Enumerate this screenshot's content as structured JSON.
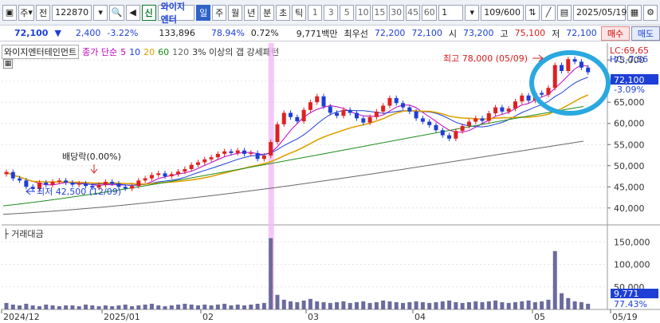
{
  "toolbar": {
    "market": "주",
    "prev_label": "전",
    "code": "122870",
    "new_badge": "신",
    "stock_name": "와이지엔터",
    "periods": [
      "일",
      "주",
      "월",
      "년",
      "분",
      "초",
      "틱"
    ],
    "active_period": "일",
    "intervals": [
      "1",
      "3",
      "5",
      "10",
      "15",
      "30",
      "45",
      "60"
    ],
    "interval_value": "1",
    "count": "109/600",
    "date": "2025/05/19"
  },
  "quote": {
    "price": "72,100",
    "change": "2,400",
    "change_rate": "-3.22%",
    "volume": "133,896",
    "ratio1": "78.94%",
    "ratio2": "0.72%",
    "amount": "9,771백만",
    "ask_label": "최우선",
    "ask": "72,200",
    "bid": "72,100",
    "open_label": "시",
    "open": "73,200",
    "high_label": "고",
    "high": "75,100",
    "low_label": "저",
    "low": "72,100",
    "buy_label": "매수",
    "sell_label": "매도"
  },
  "legend": {
    "name": "와이지엔터테인먼트",
    "price_type": "종가 단순",
    "ma": [
      "5",
      "10",
      "20",
      "60",
      "120"
    ],
    "pattern": "3% 이상의 갭 강세패턴"
  },
  "chart_data": {
    "type": "candlestick",
    "price_axis": [
      "75,000",
      "70,000",
      "65,000",
      "60,000",
      "55,000",
      "50,000",
      "45,000",
      "40,000"
    ],
    "price_range": [
      36000,
      79000
    ],
    "volume_axis": [
      "150,000",
      "100,000",
      "50,000"
    ],
    "volume_label": "거래대금",
    "x_labels": [
      "2024/12",
      "2025/01",
      "02",
      "03",
      "04",
      "05",
      "05/19"
    ],
    "annotations": {
      "high": "최고 78,000 (05/09)",
      "low": "최저 42,500 (12/09)",
      "dividend": "배당락(0.00%)"
    },
    "side_labels": {
      "lc": "LC:69,65",
      "hc": "HC:-7,56",
      "current": "72,100",
      "current_rate": "-3.09%",
      "vol_current": "9,771",
      "vol_rate": "77.43%"
    },
    "candles": [
      [
        48000,
        48500
      ],
      [
        48500,
        47000
      ],
      [
        47000,
        46500
      ],
      [
        46500,
        45000
      ],
      [
        45000,
        44500
      ],
      [
        44500,
        46000
      ],
      [
        46000,
        45500
      ],
      [
        45500,
        46200
      ],
      [
        46200,
        46500
      ],
      [
        46500,
        46000
      ],
      [
        46000,
        45500
      ],
      [
        45500,
        45800
      ],
      [
        45800,
        45200
      ],
      [
        45200,
        44800
      ],
      [
        44800,
        45500
      ],
      [
        45500,
        46200
      ],
      [
        46200,
        45800
      ],
      [
        45800,
        45000
      ],
      [
        45000,
        44600
      ],
      [
        44600,
        45200
      ],
      [
        45200,
        46500
      ],
      [
        46500,
        47000
      ],
      [
        47000,
        47800
      ],
      [
        47800,
        48200
      ],
      [
        48200,
        47500
      ],
      [
        47500,
        48000
      ],
      [
        48000,
        48600
      ],
      [
        48600,
        49200
      ],
      [
        49200,
        50200
      ],
      [
        50200,
        50800
      ],
      [
        50800,
        51500
      ],
      [
        51500,
        52000
      ],
      [
        52000,
        52800
      ],
      [
        52800,
        53400
      ],
      [
        53400,
        53000
      ],
      [
        53000,
        53600
      ],
      [
        53600,
        52800
      ],
      [
        52800,
        53000
      ],
      [
        53000,
        51600
      ],
      [
        51600,
        52400
      ],
      [
        52400,
        55600
      ],
      [
        55600,
        59800
      ],
      [
        59800,
        62500
      ],
      [
        62500,
        61500
      ],
      [
        61500,
        60500
      ],
      [
        60500,
        63200
      ],
      [
        63200,
        65000
      ],
      [
        65000,
        66400
      ],
      [
        66400,
        64000
      ],
      [
        64000,
        62500
      ],
      [
        62500,
        61800
      ],
      [
        61800,
        63200
      ],
      [
        63200,
        62500
      ],
      [
        62500,
        61200
      ],
      [
        61200,
        60200
      ],
      [
        60200,
        61500
      ],
      [
        61500,
        62800
      ],
      [
        62800,
        64200
      ],
      [
        64200,
        66000
      ],
      [
        66000,
        64800
      ],
      [
        64800,
        63800
      ],
      [
        63800,
        62800
      ],
      [
        62800,
        61200
      ],
      [
        61200,
        60400
      ],
      [
        60400,
        59600
      ],
      [
        59600,
        58400
      ],
      [
        58400,
        57200
      ],
      [
        57200,
        56400
      ],
      [
        56400,
        58200
      ],
      [
        58200,
        59400
      ],
      [
        59400,
        60400
      ],
      [
        60400,
        61200
      ],
      [
        61200,
        60600
      ],
      [
        60600,
        62400
      ],
      [
        62400,
        63800
      ],
      [
        63800,
        62800
      ],
      [
        62800,
        63500
      ],
      [
        63500,
        65200
      ],
      [
        65200,
        66600
      ],
      [
        66600,
        65400
      ],
      [
        65400,
        67200
      ],
      [
        67200,
        66800
      ],
      [
        66800,
        68400
      ],
      [
        68400,
        73800
      ],
      [
        73800,
        72400
      ],
      [
        72400,
        75200
      ],
      [
        75200,
        74600
      ],
      [
        74600,
        73200
      ],
      [
        73200,
        72100
      ]
    ],
    "volumes": [
      8,
      6,
      5,
      7,
      5,
      4,
      6,
      5,
      4,
      5,
      5,
      4,
      6,
      5,
      4,
      5,
      4,
      5,
      6,
      4,
      5,
      6,
      7,
      5,
      4,
      5,
      6,
      7,
      6,
      5,
      6,
      5,
      6,
      7,
      5,
      6,
      5,
      6,
      7,
      8,
      88,
      18,
      12,
      10,
      9,
      11,
      13,
      10,
      9,
      8,
      9,
      10,
      8,
      9,
      10,
      8,
      9,
      11,
      10,
      9,
      8,
      9,
      10,
      9,
      8,
      9,
      10,
      11,
      9,
      8,
      9,
      10,
      9,
      10,
      11,
      9,
      8,
      9,
      10,
      11,
      9,
      10,
      12,
      72,
      20,
      14,
      10,
      9,
      7
    ]
  }
}
